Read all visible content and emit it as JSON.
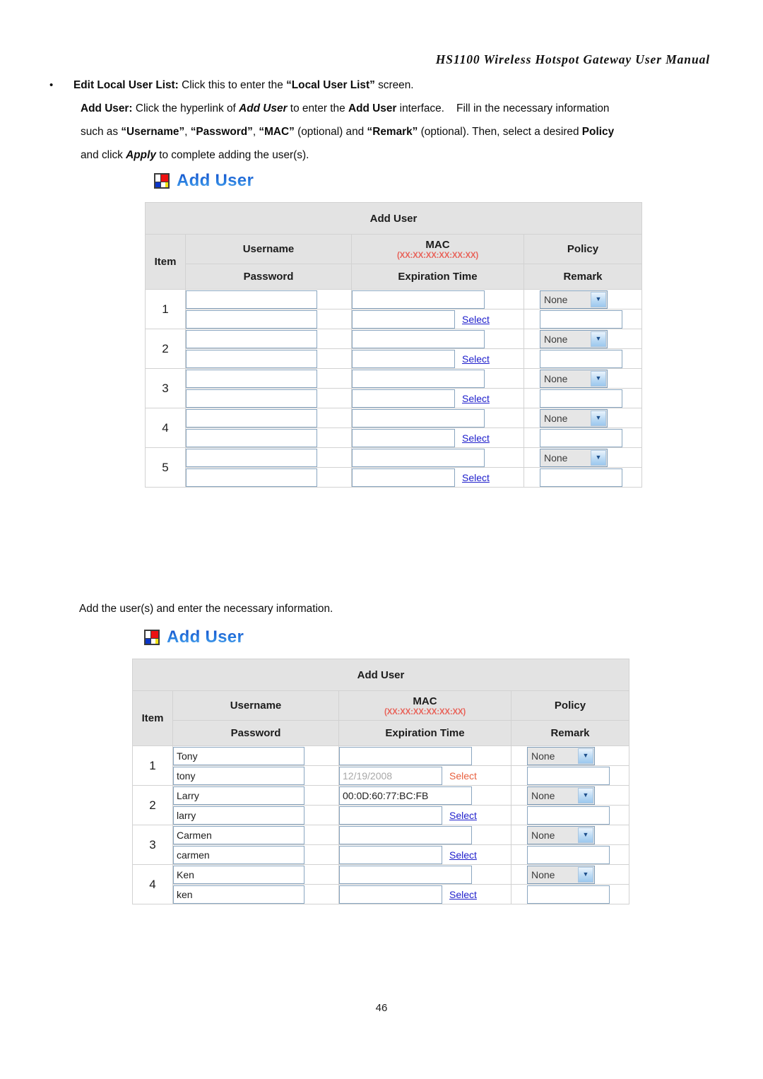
{
  "document": {
    "header_title": "HS1100 Wireless Hotspot Gateway User Manual",
    "page_number": "46"
  },
  "intro": {
    "bullet": "•",
    "line1": {
      "label": "Edit Local User List:",
      "text_a": " Click this to enter the ",
      "quoted": "“Local User List”",
      "text_b": " screen."
    },
    "line2": {
      "label": "Add User:",
      "text_a": " Click the hyperlink of ",
      "emph1": "Add User",
      "text_b": " to enter the ",
      "emph2": "Add User",
      "text_c": " interface.    Fill in the necessary information"
    },
    "line3": {
      "text_a": "such as ",
      "q1": "“Username”",
      "sep1": ", ",
      "q2": "“Password”",
      "sep2": ", ",
      "q3": "“MAC”",
      "text_b": " (optional) and ",
      "q4": "“Remark”",
      "text_c": " (optional). Then, select a desired ",
      "emph": "Policy"
    },
    "line4": {
      "text_a": "and click ",
      "emph": "Apply",
      "text_b": " to complete adding the user(s)."
    }
  },
  "mid_caption": "Add the user(s) and enter the necessary information.",
  "section1": {
    "heading": "Add User",
    "icon": "mondrian-icon"
  },
  "section2": {
    "heading": "Add User",
    "icon": "mondrian-icon"
  },
  "table": {
    "title": "Add User",
    "headers": {
      "item": "Item",
      "username": "Username",
      "mac": "MAC",
      "mac_format": "(XX:XX:XX:XX:XX:XX)",
      "policy": "Policy",
      "password": "Password",
      "expiration": "Expiration Time",
      "remark": "Remark"
    },
    "select_link": "Select",
    "policy_default": "None",
    "dropdown_arrow": "▼"
  },
  "table1_rows": [
    {
      "item": "1",
      "username": "",
      "mac": "",
      "policy": "None",
      "password": "",
      "expiration": "",
      "remark": "",
      "select_visited": false
    },
    {
      "item": "2",
      "username": "",
      "mac": "",
      "policy": "None",
      "password": "",
      "expiration": "",
      "remark": "",
      "select_visited": false
    },
    {
      "item": "3",
      "username": "",
      "mac": "",
      "policy": "None",
      "password": "",
      "expiration": "",
      "remark": "",
      "select_visited": false
    },
    {
      "item": "4",
      "username": "",
      "mac": "",
      "policy": "None",
      "password": "",
      "expiration": "",
      "remark": "",
      "select_visited": false
    },
    {
      "item": "5",
      "username": "",
      "mac": "",
      "policy": "None",
      "password": "",
      "expiration": "",
      "remark": "",
      "select_visited": false
    }
  ],
  "table2_rows": [
    {
      "item": "1",
      "username": "Tony",
      "mac": "",
      "policy": "None",
      "password": "tony",
      "expiration": "12/19/2008",
      "remark": "",
      "select_visited": true
    },
    {
      "item": "2",
      "username": "Larry",
      "mac": "00:0D:60:77:BC:FB",
      "policy": "None",
      "password": "larry",
      "expiration": "",
      "remark": "",
      "select_visited": false
    },
    {
      "item": "3",
      "username": "Carmen",
      "mac": "",
      "policy": "None",
      "password": "carmen",
      "expiration": "",
      "remark": "",
      "select_visited": false
    },
    {
      "item": "4",
      "username": "Ken",
      "mac": "",
      "policy": "None",
      "password": "ken",
      "expiration": "",
      "remark": "",
      "select_visited": false
    }
  ],
  "colors": {
    "heading_blue": "#2a7fe0",
    "header_gray": "#e3e3e3",
    "mac_red": "#e8635a",
    "link_blue": "#2020cc",
    "link_visited": "#e8603f",
    "input_border": "#8aa6c0"
  }
}
